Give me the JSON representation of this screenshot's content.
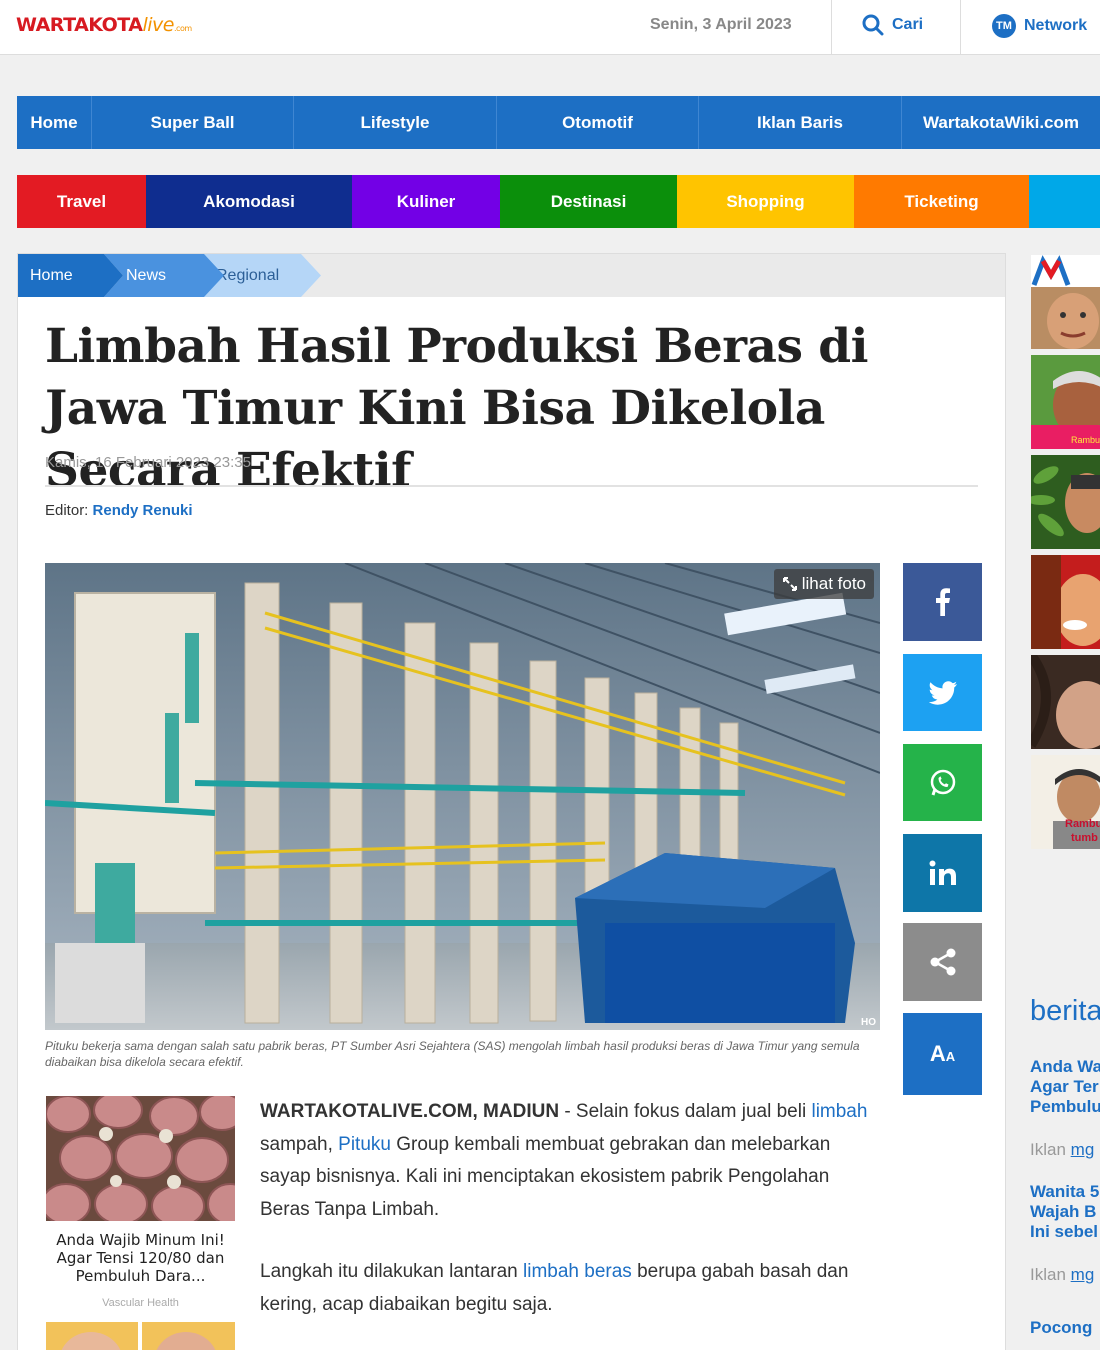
{
  "header": {
    "logo": {
      "main": "WARTAKOTA",
      "live": "live",
      "com": ".com"
    },
    "date": "Senin, 3 April 2023",
    "search_label": "Cari",
    "network_label": "Network",
    "network_badge": "TM"
  },
  "nav_main": [
    "Home",
    "Super Ball",
    "Lifestyle",
    "Otomotif",
    "Iklan Baris",
    "WartakotaWiki.com"
  ],
  "nav_color": [
    {
      "label": "Travel",
      "color": "#e31b23"
    },
    {
      "label": "Akomodasi",
      "color": "#0f2d8f"
    },
    {
      "label": "Kuliner",
      "color": "#7300e6"
    },
    {
      "label": "Destinasi",
      "color": "#0b8f0b"
    },
    {
      "label": "Shopping",
      "color": "#ffc400"
    },
    {
      "label": "Ticketing",
      "color": "#ff7a00"
    },
    {
      "label": "",
      "color": "#00a8e8"
    }
  ],
  "breadcrumb": [
    "Home",
    "News",
    "Regional"
  ],
  "article": {
    "title": "Limbah Hasil Produksi Beras di Jawa Timur Kini Bisa Dikelola Secara Efektif",
    "published": "Kamis, 16 Februari 2023 23:35",
    "editor_label": "Editor:",
    "editor_name": "Rendy Renuki",
    "photo_button": "lihat foto",
    "photo_credit": "HO",
    "caption": "Pituku bekerja sama dengan salah satu pabrik beras, PT Sumber Asri Sejahtera (SAS) mengolah limbah hasil produksi beras di Jawa Timur yang semula diabaikan bisa dikelola secara efektif.",
    "p1": {
      "dateline": "WARTAKOTALIVE.COM, MADIUN",
      "t1": " - Selain fokus dalam jual beli ",
      "link1": "limbah",
      "t2": " sampah, ",
      "link2": "Pituku",
      "t3": " Group kembali membuat gebrakan dan melebarkan sayap bisnisnya. Kali ini menciptakan ekosistem pabrik Pengolahan Beras Tanpa Limbah."
    },
    "p2": {
      "t1": "Langkah itu dilakukan lantaran ",
      "link1": "limbah beras",
      "t2": " berupa gabah basah dan kering, acap diabaikan begitu saja."
    }
  },
  "share": {
    "font_size_label": "A",
    "icons": [
      "facebook-icon",
      "twitter-icon",
      "whatsapp-icon",
      "linkedin-icon",
      "share-icon",
      "font-size-icon"
    ]
  },
  "promo": {
    "title": "Anda Wajib Minum Ini! Agar Tensi 120/80 dan Pembuluh Dara...",
    "source": "Vascular Health"
  },
  "sidebar": {
    "section_title": "berita",
    "items": [
      {
        "line1": "Anda Wa",
        "line2": "Agar Ter",
        "line3": "Pembulu"
      },
      {
        "line1": "Wanita 5",
        "line2": "Wajah B",
        "line3": "Ini sebel"
      },
      {
        "line1": "Pocong"
      }
    ],
    "iklan_label": "Iklan",
    "iklan_link": "mg",
    "thumb_captions": [
      "Rambut",
      "Rambu",
      "tumb"
    ]
  }
}
